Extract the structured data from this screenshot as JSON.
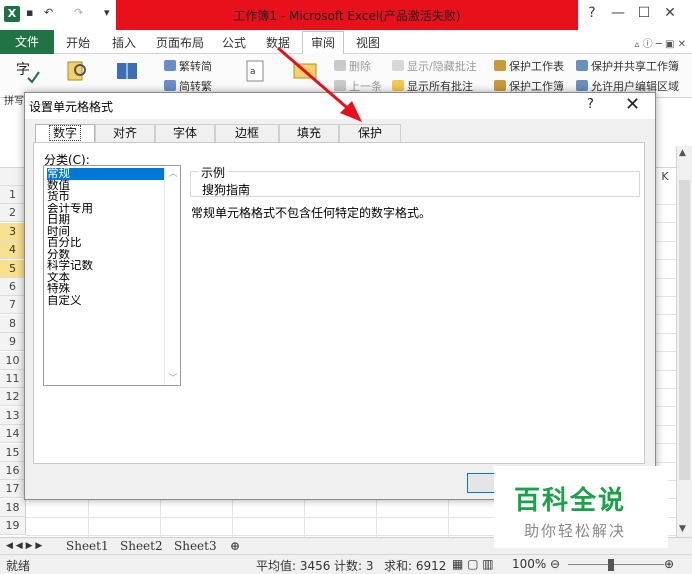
{
  "window": {
    "title": "工作簿1 - Microsoft Excel(产品激活失败)",
    "minimize": "—",
    "maximize": "☐",
    "close": "✕"
  },
  "quick_access": {
    "undo": "↶",
    "redo": "↷",
    "customize": "▾"
  },
  "ribbon_tabs": [
    {
      "label": "文件"
    },
    {
      "label": "开始"
    },
    {
      "label": "插入"
    },
    {
      "label": "页面布局"
    },
    {
      "label": "公式"
    },
    {
      "label": "数据"
    },
    {
      "label": "审阅",
      "active": true
    },
    {
      "label": "视图"
    }
  ],
  "ribbon": {
    "spelling_partial": "拼写",
    "trad_to_simp": "繁转简",
    "simp_to_trad": "简转繁",
    "delete_comment": "删除",
    "prev_comment": "上一条",
    "show_hide_comment": "显示/隐藏批注",
    "show_all_comments": "显示所有批注",
    "protect_sheet": "保护工作表",
    "protect_workbook": "保护工作簿",
    "protect_share": "保护并共享工作簿",
    "allow_edit_ranges": "允许用户编辑区域"
  },
  "grid": {
    "rows": [
      "1",
      "2",
      "3",
      "4",
      "5",
      "6",
      "7",
      "8",
      "9",
      "10",
      "11",
      "12",
      "13",
      "14",
      "15",
      "16",
      "17",
      "18",
      "19"
    ],
    "selected_rows": [
      "3",
      "4",
      "5"
    ],
    "visible_col": "K"
  },
  "dialog": {
    "title": "设置单元格格式",
    "help": "?",
    "close": "✕",
    "tabs": [
      {
        "label": "数字",
        "active": true
      },
      {
        "label": "对齐"
      },
      {
        "label": "字体"
      },
      {
        "label": "边框"
      },
      {
        "label": "填充"
      },
      {
        "label": "保护"
      }
    ],
    "category_label": "分类(C):",
    "categories": [
      "常规",
      "数值",
      "货币",
      "会计专用",
      "日期",
      "时间",
      "百分比",
      "分数",
      "科学记数",
      "文本",
      "特殊",
      "自定义"
    ],
    "selected_category": "常规",
    "sample_label": "示例",
    "sample_value": "搜狗指南",
    "description": "常规单元格格式不包含任何特定的数字格式。"
  },
  "sheets": [
    "Sheet1",
    "Sheet2",
    "Sheet3"
  ],
  "status": {
    "mode": "就绪",
    "average": "平均值: 3456",
    "count": "计数: 3",
    "sum": "求和: 6912",
    "zoom": "100%"
  },
  "watermark": {
    "title": "百科全说",
    "subtitle": "助你轻松解决"
  },
  "colors": {
    "excel_green": "#217346",
    "title_red": "#e8101a",
    "select_blue": "#0078d7",
    "row_highlight": "#f8e08e",
    "watermark_green": "#1ba14a",
    "arrow_red": "#e8101a"
  }
}
